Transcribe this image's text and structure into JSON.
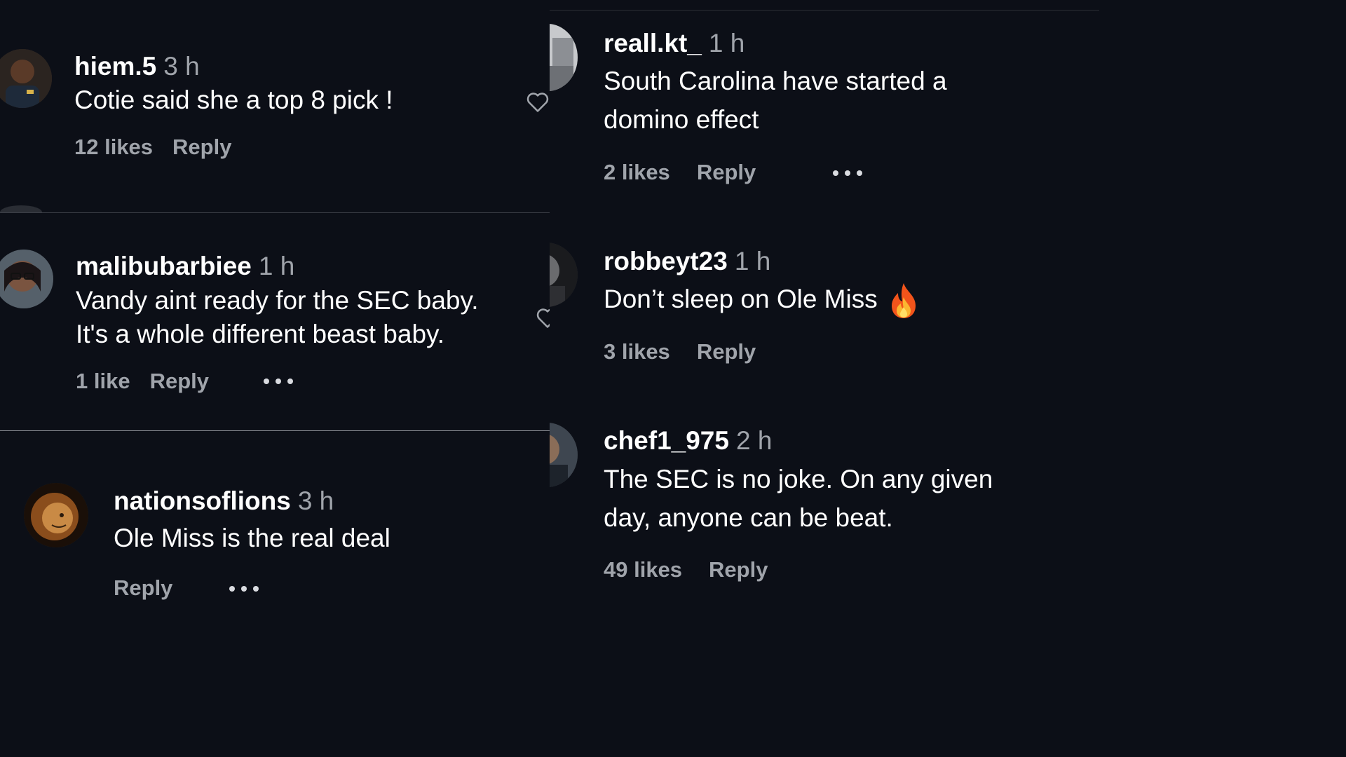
{
  "left_top": {
    "comment": {
      "username": "hiem.5",
      "time": "3 h",
      "text": "Cotie said she a top 8 pick !",
      "likes": "12 likes",
      "reply": "Reply"
    }
  },
  "left_middle": {
    "comment": {
      "username": "malibubarbiee",
      "time": "1 h",
      "text_line1": "Vandy aint ready for the SEC baby.",
      "text_line2": "It's a whole different beast baby.",
      "likes": "1 like",
      "reply": "Reply"
    }
  },
  "left_bottom": {
    "comment": {
      "username": "nationsoflions",
      "time": "3 h",
      "text": "Ole Miss is the real deal",
      "reply": "Reply"
    }
  },
  "right": {
    "comments": [
      {
        "username": "reall.kt_",
        "time": "1 h",
        "text_line1": "South Carolina have started a",
        "text_line2": "domino effect",
        "likes": "2 likes",
        "reply": "Reply"
      },
      {
        "username": "robbeyt23",
        "time": "1 h",
        "text": "Don’t sleep on Ole Miss",
        "emoji": "fire-emoji",
        "likes": "3 likes",
        "reply": "Reply"
      },
      {
        "username": "chef1_975",
        "time": "2 h",
        "text_line1": "The SEC is no joke. On any given",
        "text_line2": "day, anyone can be beat.",
        "likes": "49 likes",
        "reply": "Reply"
      }
    ]
  },
  "colors": {
    "background": "#0c0f17",
    "primary_text": "#ffffff",
    "secondary_text": "#a0a4ab"
  }
}
